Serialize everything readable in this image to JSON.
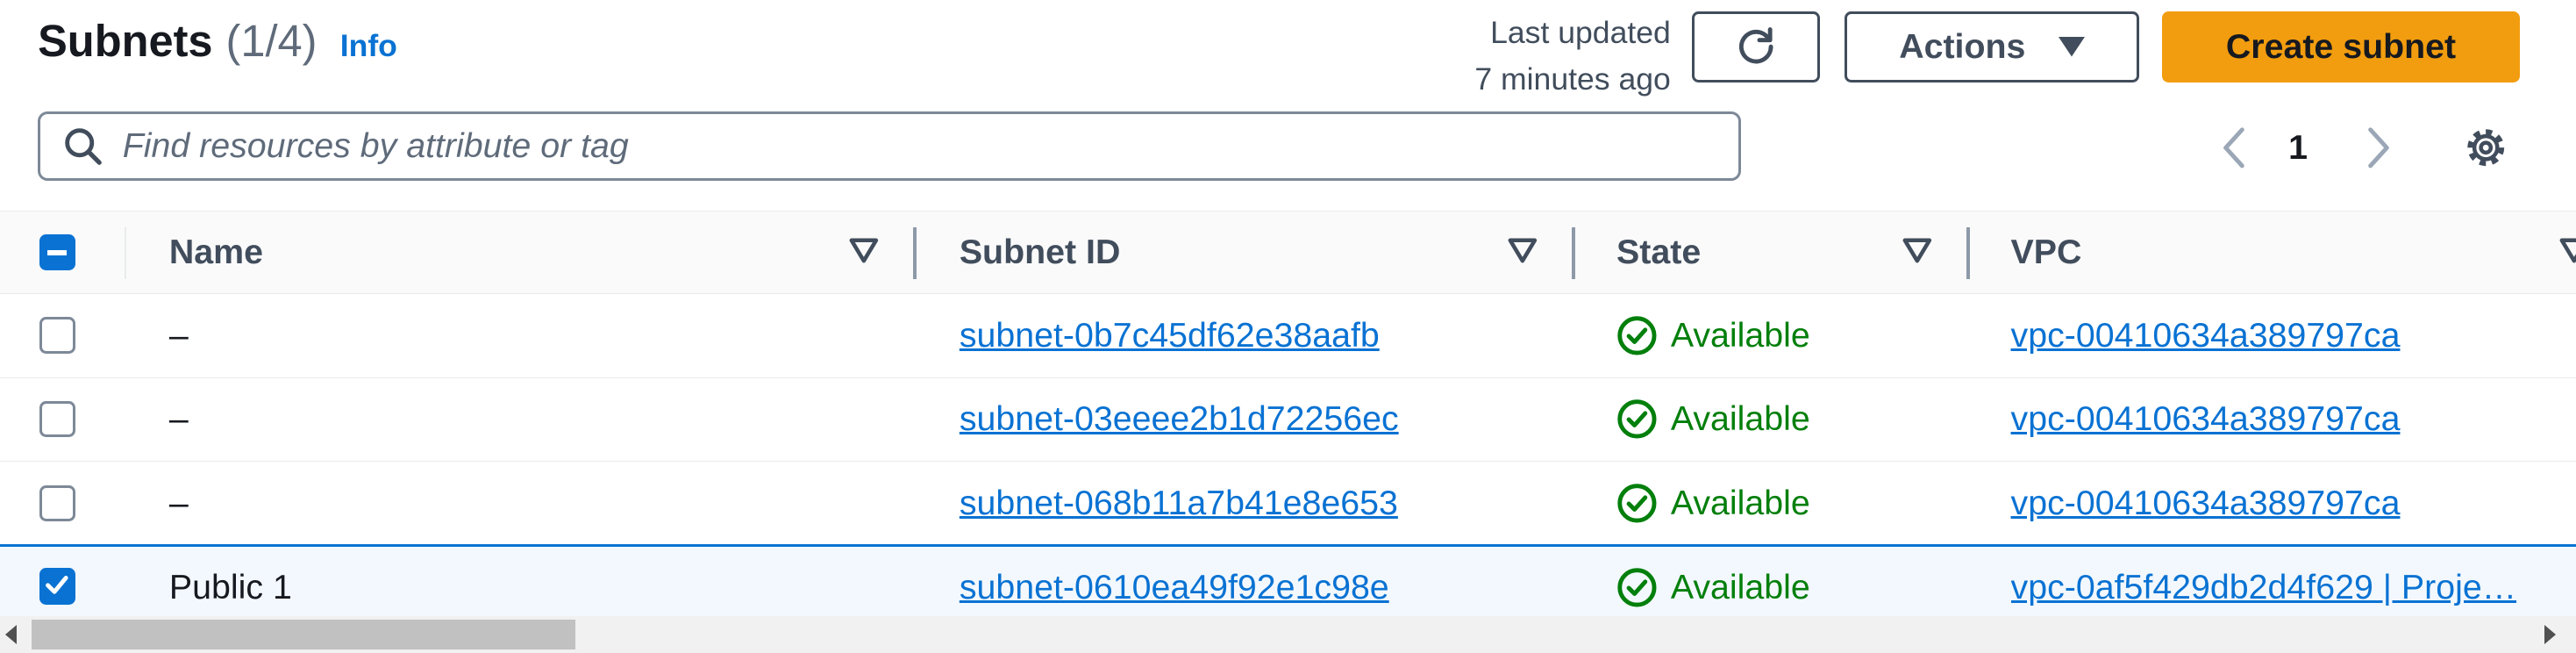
{
  "header": {
    "title": "Subnets",
    "count": "(1/4)",
    "info_link": "Info",
    "last_updated_line1": "Last updated",
    "last_updated_line2": "7 minutes ago",
    "refresh_icon": "refresh-icon",
    "actions_label": "Actions",
    "create_label": "Create subnet"
  },
  "search": {
    "placeholder": "Find resources by attribute or tag",
    "value": ""
  },
  "pagination": {
    "current_page": "1"
  },
  "table": {
    "columns": [
      "Name",
      "Subnet ID",
      "State",
      "VPC"
    ],
    "header_checkbox": "indeterminate",
    "rows": [
      {
        "selected": false,
        "name": "–",
        "subnet_id": "subnet-0b7c45df62e38aafb",
        "state": "Available",
        "vpc": "vpc-00410634a389797ca"
      },
      {
        "selected": false,
        "name": "–",
        "subnet_id": "subnet-03eeee2b1d72256ec",
        "state": "Available",
        "vpc": "vpc-00410634a389797ca"
      },
      {
        "selected": false,
        "name": "–",
        "subnet_id": "subnet-068b11a7b41e8e653",
        "state": "Available",
        "vpc": "vpc-00410634a389797ca"
      },
      {
        "selected": true,
        "name": "Public 1",
        "subnet_id": "subnet-0610ea49f92e1c98e",
        "state": "Available",
        "vpc": "vpc-0af5f429db2d4f629 | Proje…"
      }
    ]
  },
  "colors": {
    "primary_button": "#f29d0f",
    "link": "#0972d3",
    "success": "#037f0c",
    "selected_row": "#f2f8fd"
  }
}
